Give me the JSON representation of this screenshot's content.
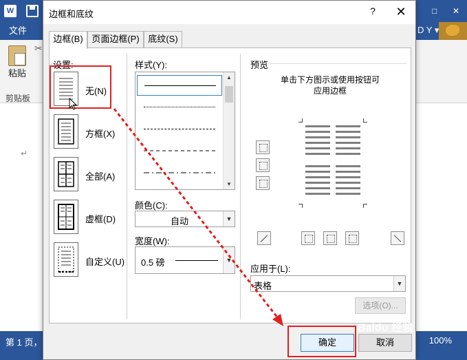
{
  "word": {
    "file_tab": "文件",
    "paste_label": "粘贴",
    "clipboard_label": "剪贴板",
    "paragraph_mark": "↵",
    "status_page": "第 1 页，",
    "zoom": "100%",
    "account_text": "D Y ▾",
    "logo_letter": "W"
  },
  "dialog": {
    "title": "边框和底纹",
    "help": "?",
    "close": "✕",
    "tabs": [
      {
        "label": "边框(B)",
        "active": true
      },
      {
        "label": "页面边框(P)",
        "active": false
      },
      {
        "label": "底纹(S)",
        "active": false
      }
    ],
    "settings": {
      "label": "设置:",
      "items": [
        {
          "label": "无(N)",
          "selected": true
        },
        {
          "label": "方框(X)"
        },
        {
          "label": "全部(A)"
        },
        {
          "label": "虚框(D)"
        },
        {
          "label": "自定义(U)"
        }
      ]
    },
    "style": {
      "label": "样式(Y):",
      "options": [
        "solid",
        "dotted-fine",
        "dashed-small",
        "dashed",
        "dash-dot"
      ]
    },
    "color": {
      "label": "颜色(C):",
      "value": "自动"
    },
    "width": {
      "label": "宽度(W):",
      "value": "0.5 磅"
    },
    "preview": {
      "label": "预览",
      "hint_line1": "单击下方图示或使用按钮可",
      "hint_line2": "应用边框"
    },
    "apply_to": {
      "label": "应用于(L):",
      "value": "表格"
    },
    "options_button": "选项(O)...",
    "ok_button": "确定",
    "cancel_button": "取消"
  },
  "watermark": "Baidu 经验",
  "accent_colors": {
    "word_blue": "#2b579a",
    "highlight_red": "#e02020"
  }
}
